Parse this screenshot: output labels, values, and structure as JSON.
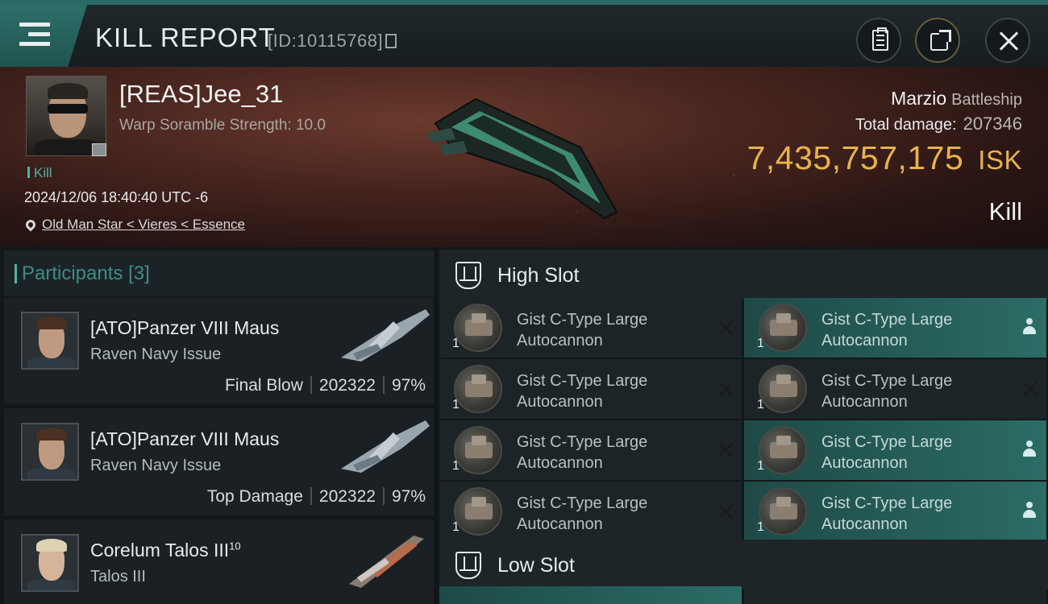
{
  "header": {
    "title": "KILL REPORT",
    "report_id": "[ID:10115768]",
    "icons": {
      "menu": "hamburger-menu-icon",
      "copy": "copy-icon",
      "clipboard": "clipboard-icon",
      "share": "share-icon",
      "close": "close-icon"
    }
  },
  "victim": {
    "name": "[REAS]Jee_31",
    "subtitle": "Warp Soramble Strength: 10.0",
    "tag": "Kill",
    "datetime": "2024/12/06 18:40:40 UTC -6",
    "location": "Old Man Star < Vieres < Essence",
    "ship_name": "Marzio",
    "ship_class": "Battleship",
    "total_damage_label": "Total damage:",
    "total_damage": "207346",
    "isk_value": "7,435,757,175",
    "isk_unit": "ISK",
    "result": "Kill",
    "colors": {
      "isk": "#e9b34a",
      "accent": "#4fb3a5"
    }
  },
  "participants": {
    "label": "Participants",
    "count": "[3]",
    "rows": [
      {
        "name": "[ATO]Panzer VIII Maus",
        "ship": "Raven Navy Issue",
        "role": "Final Blow",
        "damage": "202322",
        "percent": "97%"
      },
      {
        "name": "[ATO]Panzer VIII Maus",
        "ship": "Raven Navy Issue",
        "role": "Top Damage",
        "damage": "202322",
        "percent": "97%"
      },
      {
        "name": "Corelum Talos III",
        "name_sup": "10",
        "ship": "Talos III"
      }
    ]
  },
  "slots": {
    "high_label": "High Slot",
    "low_label": "Low Slot",
    "high": [
      {
        "name_line1": "Gist C-Type Large",
        "name_line2": "Autocannon",
        "qty": "1",
        "status": "destroyed"
      },
      {
        "name_line1": "Gist C-Type Large",
        "name_line2": "Autocannon",
        "qty": "1",
        "status": "dropped"
      },
      {
        "name_line1": "Gist C-Type Large",
        "name_line2": "Autocannon",
        "qty": "1",
        "status": "destroyed"
      },
      {
        "name_line1": "Gist C-Type Large",
        "name_line2": "Autocannon",
        "qty": "1",
        "status": "destroyed"
      },
      {
        "name_line1": "Gist C-Type Large",
        "name_line2": "Autocannon",
        "qty": "1",
        "status": "destroyed"
      },
      {
        "name_line1": "Gist C-Type Large",
        "name_line2": "Autocannon",
        "qty": "1",
        "status": "dropped"
      },
      {
        "name_line1": "Gist C-Type Large",
        "name_line2": "Autocannon",
        "qty": "1",
        "status": "destroyed"
      },
      {
        "name_line1": "Gist C-Type Large",
        "name_line2": "Autocannon",
        "qty": "1",
        "status": "dropped"
      }
    ]
  }
}
